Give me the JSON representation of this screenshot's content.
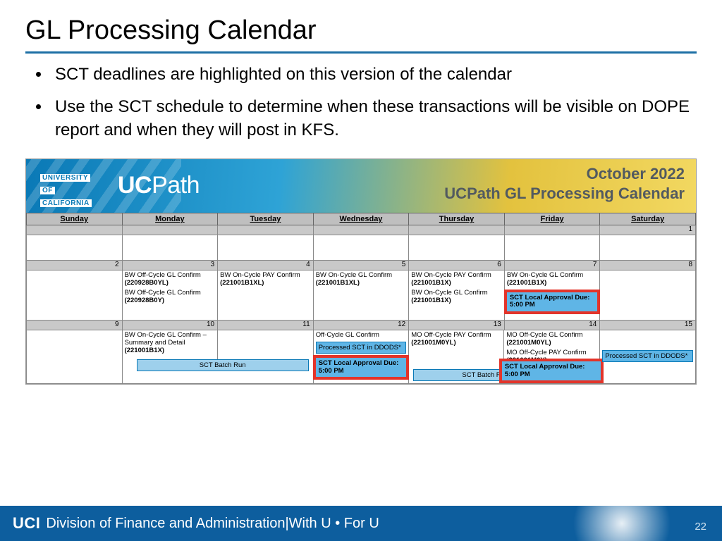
{
  "title": "GL Processing Calendar",
  "bullets": [
    "SCT deadlines are highlighted on this version of the calendar",
    "Use the SCT schedule to determine when these transactions will be visible on DOPE report and when they will post in KFS."
  ],
  "banner": {
    "uc_lines": [
      "UNIVERSITY",
      "OF",
      "CALIFORNIA"
    ],
    "ucpath_prefix": "UC",
    "ucpath_suffix": "Path",
    "month": "October 2022",
    "subtitle": "UCPath GL Processing Calendar"
  },
  "days": [
    "Sunday",
    "Monday",
    "Tuesday",
    "Wednesday",
    "Thursday",
    "Friday",
    "Saturday"
  ],
  "week1_nums": [
    "",
    "",
    "",
    "",
    "",
    "",
    "1"
  ],
  "week2_nums": [
    "2",
    "3",
    "4",
    "5",
    "6",
    "7",
    "8"
  ],
  "week3_nums": [
    "9",
    "10",
    "11",
    "12",
    "13",
    "14",
    "15"
  ],
  "w2": {
    "mon_a": "BW Off-Cycle GL Confirm",
    "mon_a_code": "(220928B0YL)",
    "mon_b": "BW Off-Cycle GL Confirm",
    "mon_b_code": "(220928B0Y)",
    "tue": "BW On-Cycle PAY Confirm",
    "tue_code": "(221001B1XL)",
    "wed": "BW On-Cycle GL Confirm",
    "wed_code": "(221001B1XL)",
    "thu_a": "BW On-Cycle PAY Confirm",
    "thu_a_code": "(221001B1X)",
    "thu_b": "BW On-Cycle GL Confirm",
    "thu_b_code": "(221001B1X)",
    "fri": "BW On-Cycle GL Confirm",
    "fri_code": "(221001B1X)",
    "fri_due": "SCT Local Approval Due: 5:00 PM"
  },
  "w3": {
    "mon": "BW On-Cycle GL Confirm – Summary and Detail",
    "mon_code": "(221001B1X)",
    "batch": "SCT Batch Run",
    "wed_top": "Off-Cycle GL Confirm",
    "wed_proc": "Processed SCT in DDODS*",
    "wed_due": "SCT Local Approval Due: 5:00 PM",
    "thu": "MO Off-Cycle PAY Confirm",
    "thu_code": "(221001M0YL)",
    "batch2": "SCT Batch Run",
    "fri_a": "MO Off-Cycle GL Confirm",
    "fri_a_code": "(221001M0YL)",
    "fri_b": "MO Off-Cycle PAY Confirm",
    "fri_b_code": "(221001M0Y)",
    "fri_due": "SCT Local Approval Due: 5:00 PM",
    "sat_proc": "Processed SCT in DDODS*"
  },
  "footer": {
    "uci": "UCI",
    "division": "Division of Finance and Administration",
    "sep": " | ",
    "tagline": "With U • For U",
    "page": "22"
  }
}
